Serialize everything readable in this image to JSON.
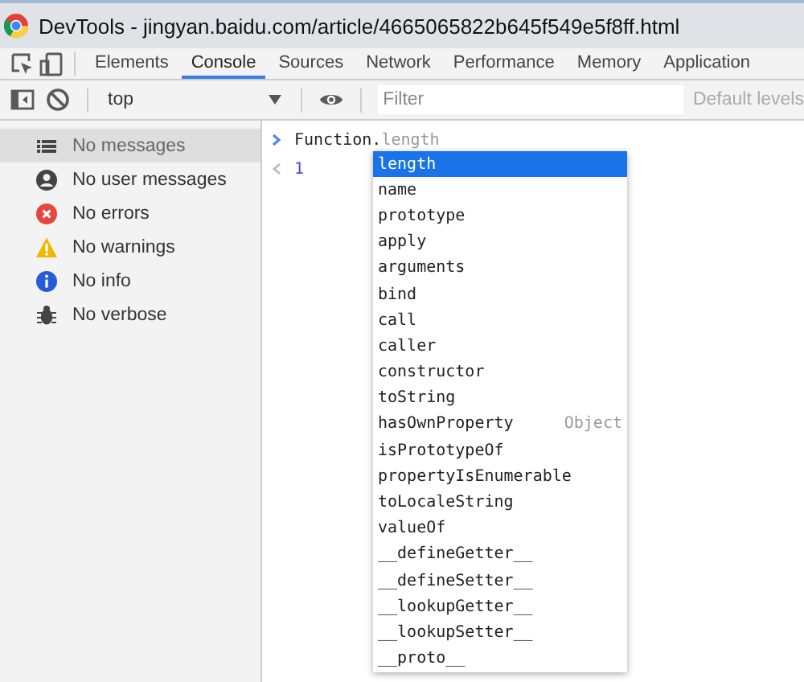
{
  "window": {
    "title": "DevTools - jingyan.baidu.com/article/4665065822b645f549e5f8ff.html"
  },
  "tabs": [
    {
      "label": "Elements",
      "selected": false
    },
    {
      "label": "Console",
      "selected": true
    },
    {
      "label": "Sources",
      "selected": false
    },
    {
      "label": "Network",
      "selected": false
    },
    {
      "label": "Performance",
      "selected": false
    },
    {
      "label": "Memory",
      "selected": false
    },
    {
      "label": "Application",
      "selected": false
    }
  ],
  "toolbar": {
    "context": "top",
    "filter_placeholder": "Filter",
    "levels": "Default levels"
  },
  "sidebar": {
    "items": [
      {
        "kind": "list",
        "label": "No messages",
        "selected": true
      },
      {
        "kind": "user",
        "label": "No user messages",
        "selected": false
      },
      {
        "kind": "error",
        "label": "No errors",
        "selected": false
      },
      {
        "kind": "warning",
        "label": "No warnings",
        "selected": false
      },
      {
        "kind": "info",
        "label": "No info",
        "selected": false
      },
      {
        "kind": "verbose",
        "label": "No verbose",
        "selected": false
      }
    ]
  },
  "console": {
    "input": "Function.",
    "hint": "length",
    "output": "1"
  },
  "autocomplete": [
    {
      "label": "length",
      "selected": true
    },
    {
      "label": "name",
      "selected": false
    },
    {
      "label": "prototype",
      "selected": false
    },
    {
      "label": "apply",
      "selected": false
    },
    {
      "label": "arguments",
      "selected": false
    },
    {
      "label": "bind",
      "selected": false
    },
    {
      "label": "call",
      "selected": false
    },
    {
      "label": "caller",
      "selected": false
    },
    {
      "label": "constructor",
      "selected": false
    },
    {
      "label": "toString",
      "selected": false
    },
    {
      "label": "hasOwnProperty",
      "selected": false,
      "source": "Object"
    },
    {
      "label": "isPrototypeOf",
      "selected": false
    },
    {
      "label": "propertyIsEnumerable",
      "selected": false
    },
    {
      "label": "toLocaleString",
      "selected": false
    },
    {
      "label": "valueOf",
      "selected": false
    },
    {
      "label": "__defineGetter__",
      "selected": false
    },
    {
      "label": "__defineSetter__",
      "selected": false
    },
    {
      "label": "__lookupGetter__",
      "selected": false
    },
    {
      "label": "__lookupSetter__",
      "selected": false
    },
    {
      "label": "__proto__",
      "selected": false
    }
  ]
}
